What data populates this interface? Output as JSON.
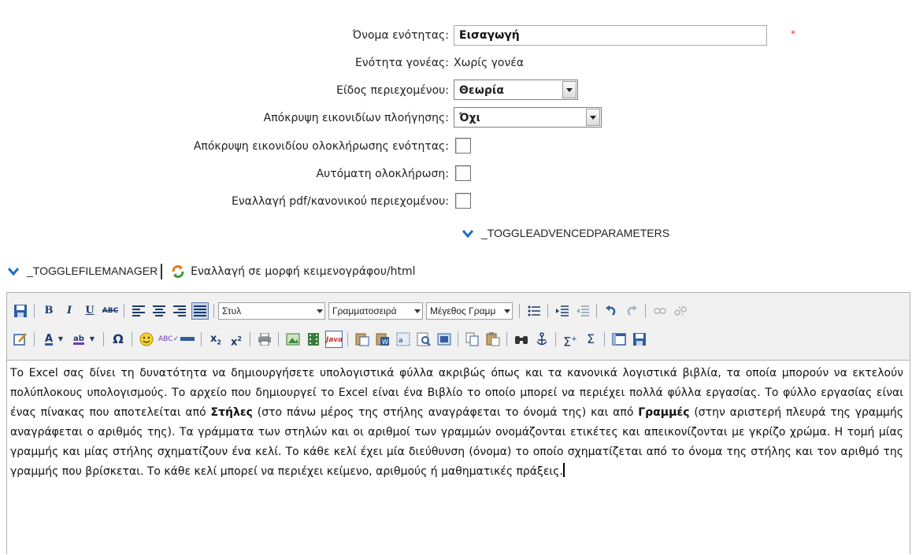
{
  "form": {
    "unit_name_label": "Όνομα ενότητας:",
    "unit_name_value": "Εισαγωγή",
    "required_mark": "*",
    "parent_label": "Ενότητα γονέας:",
    "parent_value": "Χωρίς γονέα",
    "content_type_label": "Είδος περιεχομένου:",
    "content_type_value": "Θεωρία",
    "hide_nav_label": "Απόκρυψη εικονιδίων πλοήγησης:",
    "hide_nav_value": "Όχι",
    "hide_completion_label": "Απόκρυψη εικονιδίου ολοκλήρωσης ενότητας:",
    "auto_complete_label": "Αυτόματη ολοκλήρωση:",
    "pdf_toggle_label": "Εναλλαγή pdf/κανονικού περιεχομένου:",
    "toggle_advanced": "_TOGGLEADVENCEDPARAMETERS"
  },
  "file_manager": {
    "toggle_label": "_TOGGLEFILEMANAGER",
    "html_toggle_label": "Εναλλαγή σε μορφή κειμενογράφου/html"
  },
  "toolbar": {
    "style_dropdown": "Στυλ",
    "font_dropdown": "Γραμματοσειρά",
    "size_dropdown": "Μέγεθος Γραμμ"
  },
  "editor": {
    "p1": "Το Excel σας δίνει τη δυνατότητα να δημιουργήσετε υπολογιστικά φύλλα ακριβώς όπως και τα κανονικά λογιστικά βιβλία, τα οποία μπορούν να εκτελούν πολύπλοκους υπολογισμούς. Το αρχείο που δημιουργεί το Excel είναι ένα Βιβλίο το οποίο μπορεί να περιέχει πολλά φύλλα εργασίας. Το φύλλο εργασίας είναι ένας πίνακας που αποτελείται από ",
    "bold1": "Στήλες",
    "p2": " (στο πάνω μέρος της στήλης αναγράφεται το όνομά της) και από ",
    "bold2": "Γραμμές",
    "p3": " (στην αριστερή πλευρά της γραμμής αναγράφεται ο αριθμός της). Τα γράμματα των στηλών και οι αριθμοί των γραμμών ονομάζονται ετικέτες και απεικονίζονται με γκρίζο χρώμα. Η τομή μίας γραμμής και μίας στήλης σχηματίζουν ένα κελί. Το κάθε κελί έχει μία διεύθυνση (όνομα) το οποίο σχηματίζεται από το όνομα της στήλης και τον αριθμό της γραμμής που βρίσκεται. Το κάθε κελί μπορεί να περιέχει κείμενο, αριθμούς ή μαθηματικές πράξεις."
  },
  "colors": {
    "chevron": "#1a6fc9",
    "required": "#dd3333",
    "toolbar_bg": "#f1f1f1"
  }
}
